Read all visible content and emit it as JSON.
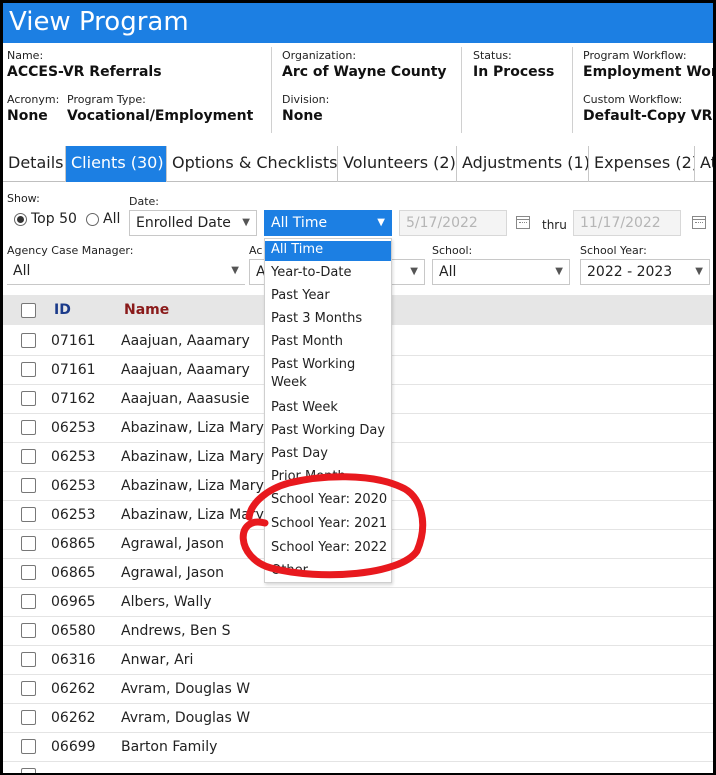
{
  "title": "View Program",
  "program": {
    "name_label": "Name:",
    "name": "ACCES-VR Referrals",
    "acronym_label": "Acronym:",
    "acronym": "None",
    "type_label": "Program Type:",
    "type": "Vocational/Employment",
    "org_label": "Organization:",
    "org": "Arc of Wayne County",
    "division_label": "Division:",
    "division": "None",
    "status_label": "Status:",
    "status": "In Process",
    "workflow_label": "Program Workflow:",
    "workflow": "Employment Workflow",
    "custom_label": "Custom Workflow:",
    "custom": "Default-Copy VR Referrals"
  },
  "tabs": [
    "Details",
    "Clients (30)",
    "Options & Checklists",
    "Volunteers (2)",
    "Adjustments (1)",
    "Expenses (2)",
    "Attachments"
  ],
  "active_tab": 1,
  "filters": {
    "show_label": "Show:",
    "top50": "Top 50",
    "all": "All",
    "date_label": "Date:",
    "date_type": "Enrolled Date",
    "range": "All Time",
    "from": "5/17/2022",
    "thru": "thru",
    "to": "11/17/2022",
    "case_manager_label": "Agency Case Manager:",
    "case_manager": "All",
    "ac_label": "Ac",
    "ac_value": "A",
    "school_label": "School:",
    "school": "All",
    "school_year_label": "School Year:",
    "school_year": "2022 - 2023"
  },
  "grid": {
    "col_id": "ID",
    "col_name": "Name",
    "rows": [
      {
        "id": "07161",
        "name": "Aaajuan, Aaamary"
      },
      {
        "id": "07161",
        "name": "Aaajuan, Aaamary"
      },
      {
        "id": "07162",
        "name": "Aaajuan, Aaasusie"
      },
      {
        "id": "06253",
        "name": "Abazinaw, Liza Mary"
      },
      {
        "id": "06253",
        "name": "Abazinaw, Liza Mary"
      },
      {
        "id": "06253",
        "name": "Abazinaw, Liza Mary"
      },
      {
        "id": "06253",
        "name": "Abazinaw, Liza Mary"
      },
      {
        "id": "06865",
        "name": "Agrawal, Jason"
      },
      {
        "id": "06865",
        "name": "Agrawal, Jason"
      },
      {
        "id": "06965",
        "name": "Albers, Wally"
      },
      {
        "id": "06580",
        "name": "Andrews, Ben S"
      },
      {
        "id": "06316",
        "name": "Anwar, Ari"
      },
      {
        "id": "06262",
        "name": "Avram, Douglas W"
      },
      {
        "id": "06262",
        "name": "Avram, Douglas W"
      },
      {
        "id": "06699",
        "name": "Barton Family"
      }
    ]
  },
  "range_options": [
    "All Time",
    "Year-to-Date",
    "Past Year",
    "Past 3 Months",
    "Past Month",
    "Past Working Week",
    "Past Week",
    "Past Working Day",
    "Past Day",
    "Prior Month",
    "School Year: 2020",
    "School Year: 2021",
    "School Year: 2022",
    "Other"
  ],
  "colors": {
    "accent": "#1c7fe3",
    "annotation": "#e8191e"
  }
}
